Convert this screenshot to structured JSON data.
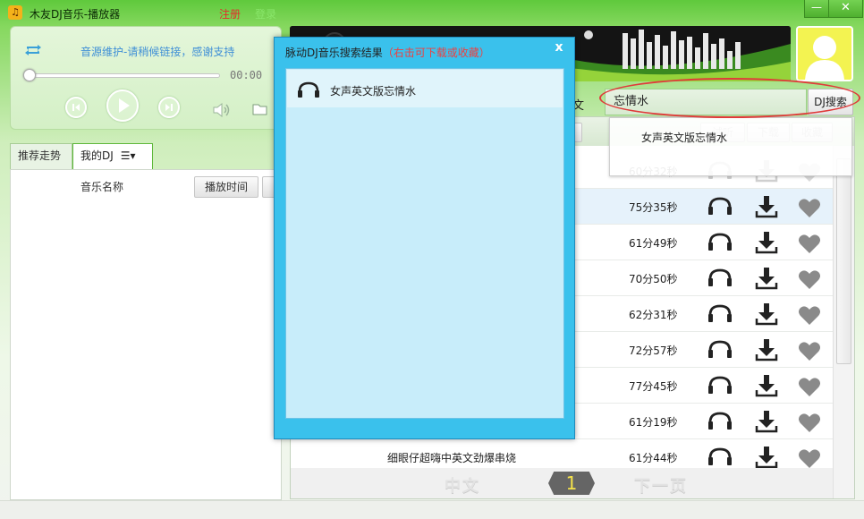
{
  "window": {
    "title": "木友DJ音乐-播放器",
    "register": "注册",
    "login": "登录",
    "min_glyph": "—",
    "close_glyph": "✕"
  },
  "player": {
    "status": "音源维护-请稍候链接，感谢支持",
    "time": "00:00"
  },
  "left_tabs": {
    "trend": "推荐走势",
    "mydj": "我的DJ",
    "menu_glyph": "☰▾"
  },
  "left_panel": {
    "col_name": "音乐名称",
    "col_time": "播放时间"
  },
  "search": {
    "value": "忘情水",
    "button": "DJ搜索",
    "partial_tab": "文",
    "suggestion": "女声英文版忘情水"
  },
  "right_header": {
    "listen": "试听",
    "download": "下载",
    "favorite": "收藏"
  },
  "rows": [
    {
      "name": "",
      "duration": "60分32秒",
      "faded": true
    },
    {
      "name": "",
      "duration": "75分35秒",
      "highlighted": true
    },
    {
      "name": "",
      "duration": "61分49秒"
    },
    {
      "name": "",
      "duration": "70分50秒"
    },
    {
      "name": "",
      "duration": "62分31秒"
    },
    {
      "name": "",
      "duration": "72分57秒"
    },
    {
      "name": "",
      "duration": "77分45秒"
    },
    {
      "name": "",
      "duration": "61分19秒"
    },
    {
      "name": "细眼仔超嗨中英文劲爆串烧",
      "duration": "61分44秒"
    }
  ],
  "pager": {
    "prev": "中文",
    "page": "1",
    "next": "下一页"
  },
  "dialog": {
    "title": "脉动DJ音乐搜索结果",
    "tip": "（右击可下载或收藏）",
    "close": "x",
    "result": "女声英文版忘情水"
  },
  "colors": {
    "accent_green": "#5fc93c",
    "dialog_blue": "#3ac1ec",
    "highlight_red": "#e03a3a",
    "page_digit": "#f5e24a"
  }
}
